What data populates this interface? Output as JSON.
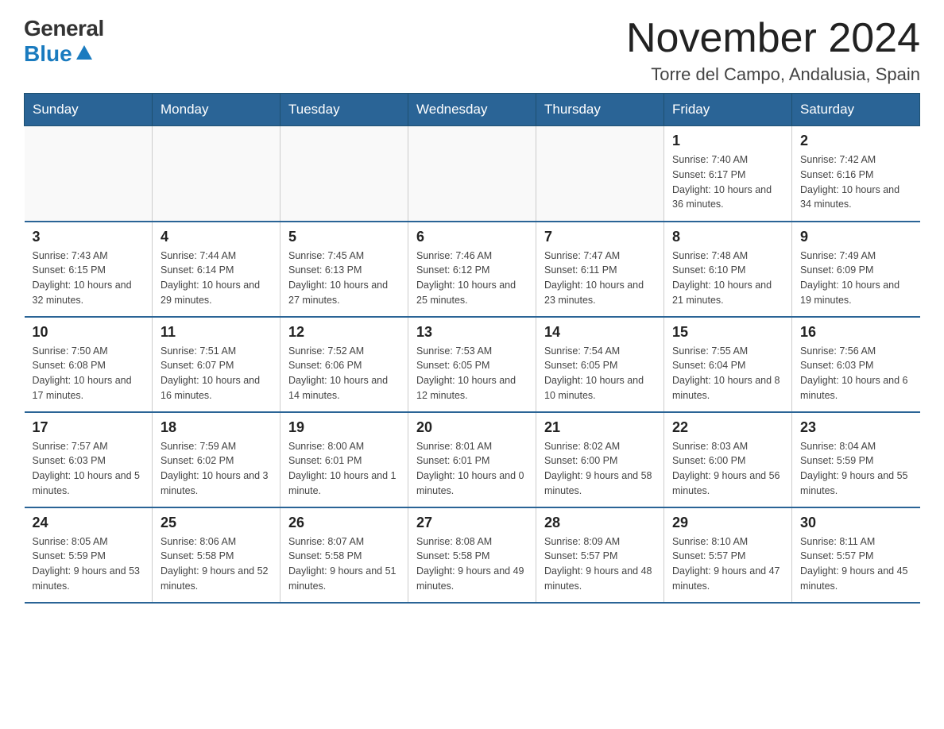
{
  "logo": {
    "general": "General",
    "blue": "Blue",
    "triangle_label": "logo-triangle"
  },
  "header": {
    "month_year": "November 2024",
    "location": "Torre del Campo, Andalusia, Spain"
  },
  "weekdays": [
    "Sunday",
    "Monday",
    "Tuesday",
    "Wednesday",
    "Thursday",
    "Friday",
    "Saturday"
  ],
  "weeks": [
    {
      "days": [
        {
          "number": "",
          "info": ""
        },
        {
          "number": "",
          "info": ""
        },
        {
          "number": "",
          "info": ""
        },
        {
          "number": "",
          "info": ""
        },
        {
          "number": "",
          "info": ""
        },
        {
          "number": "1",
          "info": "Sunrise: 7:40 AM\nSunset: 6:17 PM\nDaylight: 10 hours and 36 minutes."
        },
        {
          "number": "2",
          "info": "Sunrise: 7:42 AM\nSunset: 6:16 PM\nDaylight: 10 hours and 34 minutes."
        }
      ]
    },
    {
      "days": [
        {
          "number": "3",
          "info": "Sunrise: 7:43 AM\nSunset: 6:15 PM\nDaylight: 10 hours and 32 minutes."
        },
        {
          "number": "4",
          "info": "Sunrise: 7:44 AM\nSunset: 6:14 PM\nDaylight: 10 hours and 29 minutes."
        },
        {
          "number": "5",
          "info": "Sunrise: 7:45 AM\nSunset: 6:13 PM\nDaylight: 10 hours and 27 minutes."
        },
        {
          "number": "6",
          "info": "Sunrise: 7:46 AM\nSunset: 6:12 PM\nDaylight: 10 hours and 25 minutes."
        },
        {
          "number": "7",
          "info": "Sunrise: 7:47 AM\nSunset: 6:11 PM\nDaylight: 10 hours and 23 minutes."
        },
        {
          "number": "8",
          "info": "Sunrise: 7:48 AM\nSunset: 6:10 PM\nDaylight: 10 hours and 21 minutes."
        },
        {
          "number": "9",
          "info": "Sunrise: 7:49 AM\nSunset: 6:09 PM\nDaylight: 10 hours and 19 minutes."
        }
      ]
    },
    {
      "days": [
        {
          "number": "10",
          "info": "Sunrise: 7:50 AM\nSunset: 6:08 PM\nDaylight: 10 hours and 17 minutes."
        },
        {
          "number": "11",
          "info": "Sunrise: 7:51 AM\nSunset: 6:07 PM\nDaylight: 10 hours and 16 minutes."
        },
        {
          "number": "12",
          "info": "Sunrise: 7:52 AM\nSunset: 6:06 PM\nDaylight: 10 hours and 14 minutes."
        },
        {
          "number": "13",
          "info": "Sunrise: 7:53 AM\nSunset: 6:05 PM\nDaylight: 10 hours and 12 minutes."
        },
        {
          "number": "14",
          "info": "Sunrise: 7:54 AM\nSunset: 6:05 PM\nDaylight: 10 hours and 10 minutes."
        },
        {
          "number": "15",
          "info": "Sunrise: 7:55 AM\nSunset: 6:04 PM\nDaylight: 10 hours and 8 minutes."
        },
        {
          "number": "16",
          "info": "Sunrise: 7:56 AM\nSunset: 6:03 PM\nDaylight: 10 hours and 6 minutes."
        }
      ]
    },
    {
      "days": [
        {
          "number": "17",
          "info": "Sunrise: 7:57 AM\nSunset: 6:03 PM\nDaylight: 10 hours and 5 minutes."
        },
        {
          "number": "18",
          "info": "Sunrise: 7:59 AM\nSunset: 6:02 PM\nDaylight: 10 hours and 3 minutes."
        },
        {
          "number": "19",
          "info": "Sunrise: 8:00 AM\nSunset: 6:01 PM\nDaylight: 10 hours and 1 minute."
        },
        {
          "number": "20",
          "info": "Sunrise: 8:01 AM\nSunset: 6:01 PM\nDaylight: 10 hours and 0 minutes."
        },
        {
          "number": "21",
          "info": "Sunrise: 8:02 AM\nSunset: 6:00 PM\nDaylight: 9 hours and 58 minutes."
        },
        {
          "number": "22",
          "info": "Sunrise: 8:03 AM\nSunset: 6:00 PM\nDaylight: 9 hours and 56 minutes."
        },
        {
          "number": "23",
          "info": "Sunrise: 8:04 AM\nSunset: 5:59 PM\nDaylight: 9 hours and 55 minutes."
        }
      ]
    },
    {
      "days": [
        {
          "number": "24",
          "info": "Sunrise: 8:05 AM\nSunset: 5:59 PM\nDaylight: 9 hours and 53 minutes."
        },
        {
          "number": "25",
          "info": "Sunrise: 8:06 AM\nSunset: 5:58 PM\nDaylight: 9 hours and 52 minutes."
        },
        {
          "number": "26",
          "info": "Sunrise: 8:07 AM\nSunset: 5:58 PM\nDaylight: 9 hours and 51 minutes."
        },
        {
          "number": "27",
          "info": "Sunrise: 8:08 AM\nSunset: 5:58 PM\nDaylight: 9 hours and 49 minutes."
        },
        {
          "number": "28",
          "info": "Sunrise: 8:09 AM\nSunset: 5:57 PM\nDaylight: 9 hours and 48 minutes."
        },
        {
          "number": "29",
          "info": "Sunrise: 8:10 AM\nSunset: 5:57 PM\nDaylight: 9 hours and 47 minutes."
        },
        {
          "number": "30",
          "info": "Sunrise: 8:11 AM\nSunset: 5:57 PM\nDaylight: 9 hours and 45 minutes."
        }
      ]
    }
  ]
}
